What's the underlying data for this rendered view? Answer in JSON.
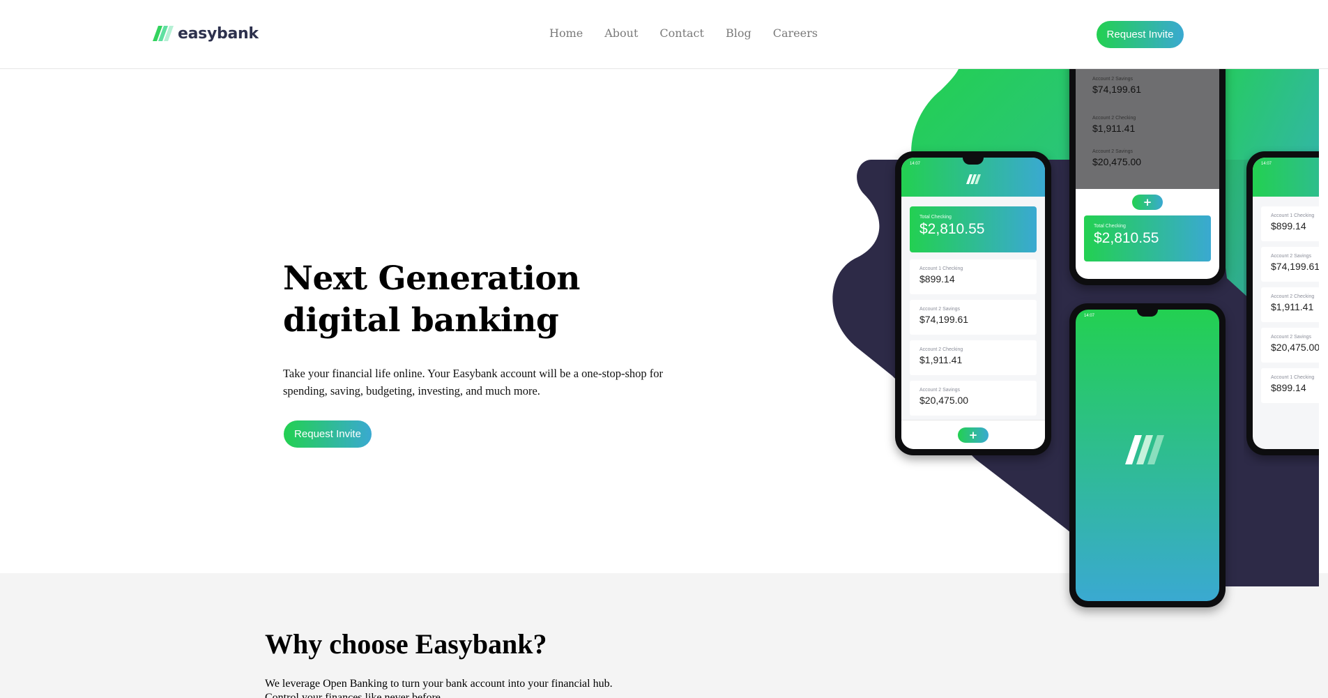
{
  "header": {
    "logo_text": "easybank",
    "nav": [
      "Home",
      "About",
      "Contact",
      "Blog",
      "Careers"
    ],
    "cta": "Request Invite"
  },
  "hero": {
    "title_line1": "Next Generation",
    "title_line2": "digital banking",
    "description": "Take your financial life online. Your Easybank account will be a one-stop-shop for spending, saving, budgeting, investing, and much more.",
    "cta": "Request Invite"
  },
  "why": {
    "title": "Why choose Easybank?",
    "line1": "We leverage Open Banking to turn your bank account into your financial hub.",
    "line2": "Control your finances like never before."
  },
  "mockup": {
    "time": "14:07",
    "total_label": "Total Checking",
    "total_amount": "$2,810.55",
    "plus": "+",
    "accounts": [
      {
        "label": "Account 1 Checking",
        "amount": "$899.14"
      },
      {
        "label": "Account 2 Savings",
        "amount": "$74,199.61"
      },
      {
        "label": "Account 2 Checking",
        "amount": "$1,911.41"
      },
      {
        "label": "Account 2 Savings",
        "amount": "$20,475.00"
      }
    ]
  },
  "colors": {
    "brand_green": "#23d051",
    "brand_cyan": "#3aa9d1",
    "dark_blue": "#2d314d"
  }
}
